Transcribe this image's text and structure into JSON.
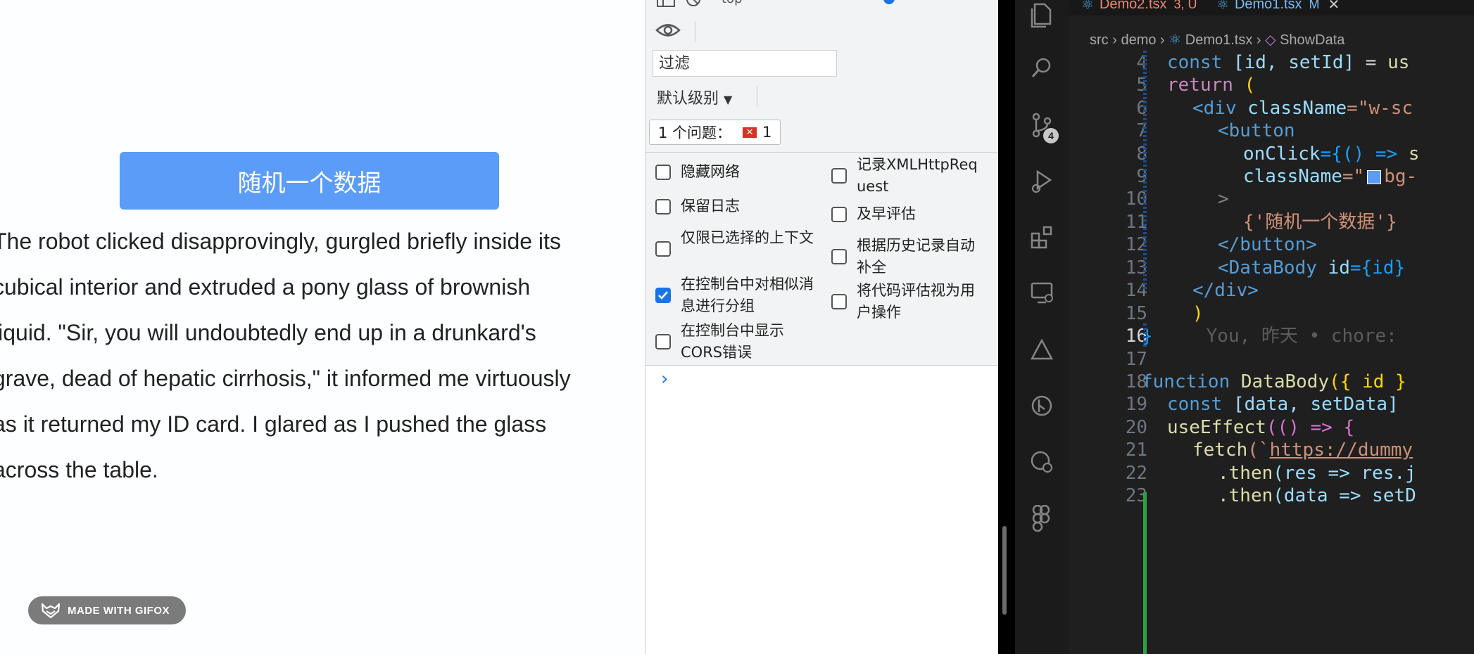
{
  "app": {
    "button_label": "随机一个数据",
    "quote_lines": [
      "The robot clicked disapprovingly, gurgled briefly inside its",
      "cubical interior and extruded a pony glass of brownish",
      "liquid. \"Sir, you will undoubtedly end up in a drunkard's",
      "grave, dead of hepatic cirrhosis,\" it informed me virtuously",
      "as it returned my ID card. I glared as I pushed the glass",
      "across the table."
    ],
    "badge_text": "MADE WITH GIFOX"
  },
  "devtools": {
    "top_cut_text": "top",
    "filter_placeholder": "过滤",
    "level_label": "默认级别",
    "issues_label": "1 个问题：",
    "issues_count": "1",
    "options_left": [
      {
        "label": "隐藏网络",
        "checked": false
      },
      {
        "label": "保留日志",
        "checked": false
      },
      {
        "label": "仅限已选择的上下文",
        "checked": false
      },
      {
        "label": "在控制台中对相似消息进行分组",
        "checked": true
      },
      {
        "label": "在控制台中显示CORS错误",
        "checked": false
      }
    ],
    "options_right": [
      {
        "label": "记录XMLHttpRequest",
        "checked": false
      },
      {
        "label": "及早评估",
        "checked": false
      },
      {
        "label": "根据历史记录自动补全",
        "checked": false
      },
      {
        "label": "将代码评估视为用户操作",
        "checked": false
      }
    ],
    "prompt_symbol": "›"
  },
  "editor": {
    "tabs": [
      {
        "name": "Demo2.tsx",
        "status": "3, U",
        "color": "#f48771"
      },
      {
        "name": "Demo1.tsx",
        "status": "M",
        "color": "#75beff",
        "active": true
      }
    ],
    "breadcrumb": [
      "src",
      "demo",
      "Demo1.tsx",
      "ShowData"
    ],
    "scm_badge": "4",
    "line_numbers": [
      "4",
      "5",
      "6",
      "7",
      "8",
      "9",
      "10",
      "11",
      "12",
      "13",
      "14",
      "15",
      "16",
      "17",
      "18",
      "19",
      "20",
      "21",
      "22",
      "23"
    ],
    "current_line": "16",
    "blame_text": "You, 昨天 • chore:",
    "code": {
      "l4": [
        "const",
        "[id, setId]",
        "=",
        "us"
      ],
      "l5": [
        "return",
        "("
      ],
      "l6": [
        "<div",
        "className",
        "=\"w-sc"
      ],
      "l7": [
        "<button"
      ],
      "l8": [
        "onClick",
        "={() =>",
        "s"
      ],
      "l9": [
        "className",
        "=\"",
        "bg-"
      ],
      "l10": [
        ">"
      ],
      "l11": [
        "{'随机一个数据'}"
      ],
      "l12": [
        "</button>"
      ],
      "l13": [
        "<DataBody",
        "id",
        "={id}"
      ],
      "l14": [
        "</div>"
      ],
      "l15": [
        ")"
      ],
      "l16": [
        "}"
      ],
      "l17": [
        ""
      ],
      "l18": [
        "function",
        "DataBody",
        "({ id }"
      ],
      "l19": [
        "const",
        "[data, setData]"
      ],
      "l20": [
        "useEffect",
        "(() => {"
      ],
      "l21": [
        "fetch",
        "(`",
        "https://dummy"
      ],
      "l22": [
        ".then",
        "(res => res.j"
      ],
      "l23": [
        ".then",
        "(data => setD"
      ]
    }
  },
  "colors": {
    "button_bg": "#5a9cf8",
    "editor_bg": "#1f1f1f",
    "checkbox_checked": "#1a73e8"
  }
}
